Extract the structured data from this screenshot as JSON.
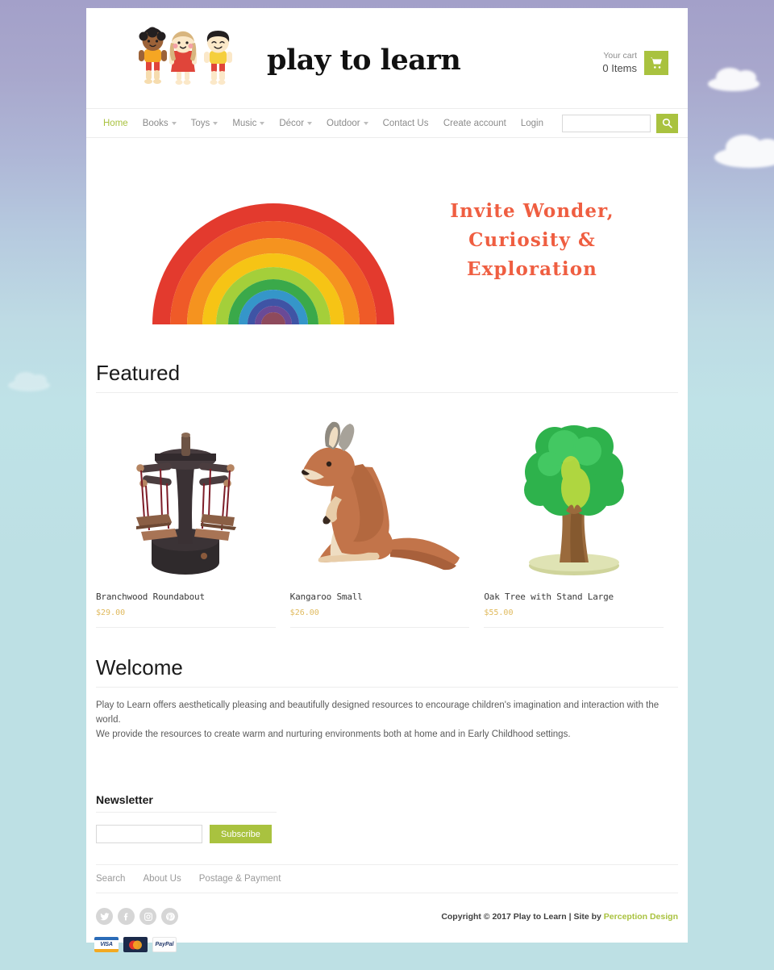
{
  "site": {
    "logo_text": "play to learn",
    "logo_image": "three-children-illustration"
  },
  "cart": {
    "label": "Your cart",
    "count_text": "0 Items",
    "icon": "shopping-cart-icon",
    "accent_color": "#a9c23f"
  },
  "nav": {
    "items": [
      {
        "label": "Home",
        "has_dropdown": false,
        "active": true
      },
      {
        "label": "Books",
        "has_dropdown": true,
        "active": false
      },
      {
        "label": "Toys",
        "has_dropdown": true,
        "active": false
      },
      {
        "label": "Music",
        "has_dropdown": true,
        "active": false
      },
      {
        "label": "Décor",
        "has_dropdown": true,
        "active": false
      },
      {
        "label": "Outdoor",
        "has_dropdown": true,
        "active": false
      },
      {
        "label": "Contact Us",
        "has_dropdown": false,
        "active": false
      }
    ],
    "account": [
      {
        "label": "Create account"
      },
      {
        "label": "Login"
      }
    ],
    "search": {
      "value": "",
      "placeholder": "",
      "button_icon": "search-icon"
    }
  },
  "hero": {
    "image": "wooden-rainbow-stacker",
    "headline_line1": "Invite Wonder,",
    "headline_line2": "Curiosity &",
    "headline_line3": "Exploration",
    "headline_color": "#ef5e41"
  },
  "featured": {
    "title": "Featured",
    "products": [
      {
        "name": "Branchwood Roundabout",
        "price": "$29.00",
        "image": "wooden-roundabout-carousel-toy"
      },
      {
        "name": "Kangaroo Small",
        "price": "$26.00",
        "image": "carved-wooden-kangaroo"
      },
      {
        "name": "Oak Tree with Stand Large",
        "price": "$55.00",
        "image": "wooden-oak-tree-with-stand"
      }
    ],
    "price_color": "#e0ba5e"
  },
  "welcome": {
    "title": "Welcome",
    "paragraph1": "Play to Learn offers aesthetically pleasing and beautifully designed resources to encourage children's imagination and interaction with the world.",
    "paragraph2": "We provide the resources to create warm and nurturing environments both at home and in Early Childhood settings."
  },
  "newsletter": {
    "title": "Newsletter",
    "input_value": "",
    "input_placeholder": "",
    "button_label": "Subscribe"
  },
  "footer": {
    "links": [
      {
        "label": "Search"
      },
      {
        "label": "About Us"
      },
      {
        "label": "Postage & Payment"
      }
    ],
    "socials": [
      {
        "name": "twitter-icon",
        "glyph": "t"
      },
      {
        "name": "facebook-icon",
        "glyph": "f"
      },
      {
        "name": "instagram-icon",
        "glyph": "i"
      },
      {
        "name": "pinterest-icon",
        "glyph": "p"
      }
    ],
    "copyright_text": "Copyright © 2017 Play to Learn  |  Site by ",
    "credit_label": "Perception Design",
    "payments": [
      {
        "name": "visa",
        "label": "VISA"
      },
      {
        "name": "mastercard",
        "label": ""
      },
      {
        "name": "paypal",
        "label": "PayPal"
      }
    ]
  }
}
